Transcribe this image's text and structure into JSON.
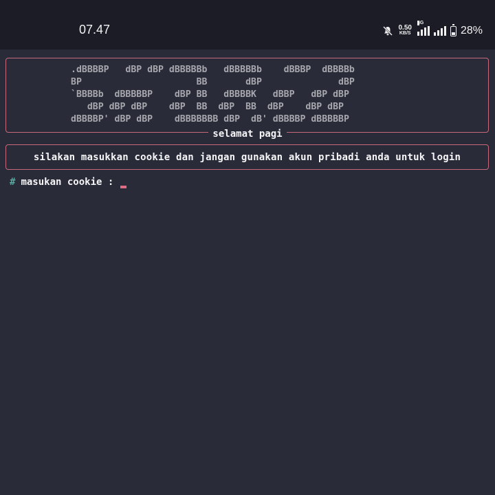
{
  "status_bar": {
    "time": "07.47",
    "net_speed_value": "0.50",
    "net_speed_unit": "KB/S",
    "network_type": "4G",
    "battery_percent": "28%",
    "battery_level": 0.28,
    "icons": [
      "mute-bell-icon",
      "signal-4g-icon",
      "signal-icon",
      "battery-icon"
    ]
  },
  "terminal": {
    "ascii_banner": ".dBBBBP   dBP dBP dBBBBBb   dBBBBBb    dBBBP  dBBBBb\nBP                     BB       dBP              dBP\n`BBBBb  dBBBBBP    dBP BB   dBBBBK   dBBP   dBP dBP\n   dBP dBP dBP    dBP  BB  dBP  BB  dBP    dBP dBP\ndBBBBP' dBP dBP    dBBBBBBB dBP  dB' dBBBBP dBBBBBP",
    "greeting": "selamat pagi",
    "notice": "silakan masukkan cookie dan jangan gunakan akun pribadi anda untuk login",
    "prompt_symbol": "#",
    "prompt_label": "masukan cookie :",
    "input_value": ""
  },
  "colors": {
    "background": "#2a2b38",
    "status_bar": "#1b1c26",
    "box_border": "#c86a7b",
    "ascii_text": "#a7a7ae",
    "prompt_hash": "#5aa7a0",
    "cursor": "#e26a82"
  }
}
